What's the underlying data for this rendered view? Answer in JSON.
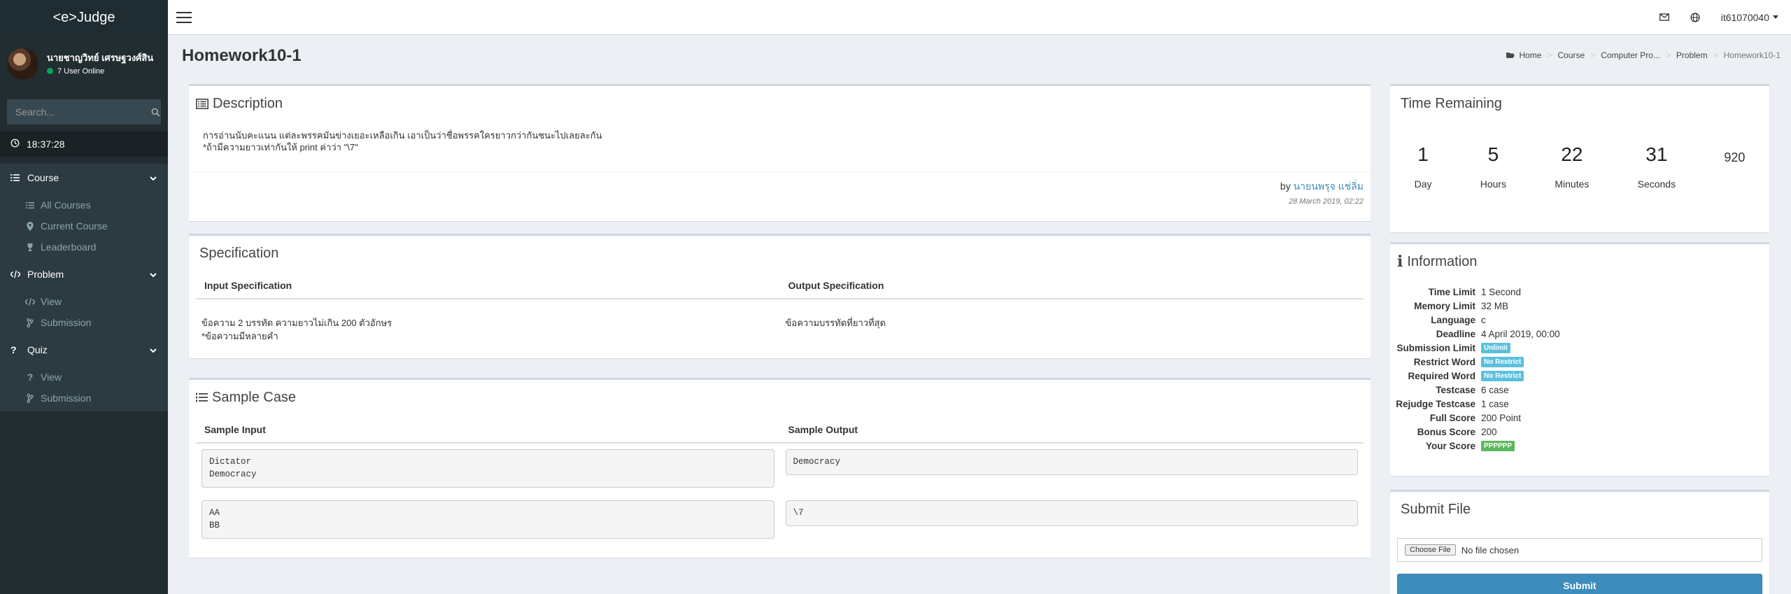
{
  "app": {
    "logo": "<e>Judge"
  },
  "user": {
    "name": "นายชาญวิทย์ เศรษฐวงศ์สิน",
    "status": "7 User Online",
    "username": "it61070040"
  },
  "search": {
    "placeholder": "Search..."
  },
  "clock": "18:37:28",
  "sidebar": {
    "sections": [
      {
        "label": "Course",
        "icon": "list-icon",
        "items": [
          {
            "label": "All Courses",
            "icon": "list-icon"
          },
          {
            "label": "Current Course",
            "icon": "map-marker-icon"
          },
          {
            "label": "Leaderboard",
            "icon": "trophy-icon"
          }
        ]
      },
      {
        "label": "Problem",
        "icon": "code-icon",
        "items": [
          {
            "label": "View",
            "icon": "code-icon"
          },
          {
            "label": "Submission",
            "icon": "git-branch-icon"
          }
        ]
      },
      {
        "label": "Quiz",
        "icon": "question-icon",
        "items": [
          {
            "label": "View",
            "icon": "question-icon"
          },
          {
            "label": "Submission",
            "icon": "git-branch-icon"
          }
        ]
      }
    ]
  },
  "page": {
    "title": "Homework10-1"
  },
  "breadcrumb": [
    "Home",
    "Course",
    "Computer Pro...",
    "Problem",
    "Homework10-1"
  ],
  "description": {
    "title": "Description",
    "lines": [
      "การอ่านนับคะแนน แต่ละพรรคมันข่างเยอะเหลือเกิน เอาเป็นว่าชื่อพรรคใครยาวกว่ากันชนะไปเลยละกัน",
      "*ถ้ามีความยาวเท่ากันให้ print ค่าว่า \"\\7\""
    ],
    "by": "by",
    "author": "นายนพรุจ แช่ลิ่ม",
    "date": "28 March 2019, 02:22"
  },
  "specification": {
    "title": "Specification",
    "input_header": "Input Specification",
    "output_header": "Output Specification",
    "input_lines": [
      "ข้อความ 2 บรรทัด ความยาวไม่เกิน 200 ตัวอักษร",
      "*ข้อความมีหลายคำ"
    ],
    "output_text": "ข้อความบรรทัดที่ยาวที่สุด"
  },
  "sample": {
    "title": "Sample Case",
    "input_header": "Sample Input",
    "output_header": "Sample Output",
    "cases": [
      {
        "input": "Dictator\nDemocracy",
        "output": "Democracy"
      },
      {
        "input": "AA\nBB",
        "output": "\\7"
      }
    ]
  },
  "time_remaining": {
    "title": "Time Remaining",
    "units": [
      {
        "value": "1",
        "label": "Day"
      },
      {
        "value": "5",
        "label": "Hours"
      },
      {
        "value": "22",
        "label": "Minutes"
      },
      {
        "value": "31",
        "label": "Seconds"
      }
    ],
    "extra": "920"
  },
  "information": {
    "title": "Information",
    "rows": [
      {
        "key": "Time Limit",
        "value": "1 Second"
      },
      {
        "key": "Memory Limit",
        "value": "32 MB"
      },
      {
        "key": "Language",
        "value": "c"
      },
      {
        "key": "Deadline",
        "value": "4 April 2019, 00:00"
      },
      {
        "key": "Submission Limit",
        "badge": "Unlimit",
        "badge_color": "#5bc0de"
      },
      {
        "key": "Restrict Word",
        "badge": "No Restrict",
        "badge_color": "#5bc0de"
      },
      {
        "key": "Required Word",
        "badge": "No Restrict",
        "badge_color": "#5bc0de"
      },
      {
        "key": "Testcase",
        "value": "6 case"
      },
      {
        "key": "Rejudge Testcase",
        "value": "1 case"
      },
      {
        "key": "Full Score",
        "value": "200 Point"
      },
      {
        "key": "Bonus Score",
        "value": "200"
      },
      {
        "key": "Your Score",
        "badge": "PPPPPP",
        "badge_color": "#5cb85c"
      }
    ]
  },
  "submit_file": {
    "title": "Submit File",
    "choose_label": "Choose File",
    "no_file": "No file chosen",
    "submit_label": "Submit"
  },
  "colors": {
    "sidebar_bg": "#222d32",
    "accent": "#3c8dbc",
    "badge_info": "#5bc0de",
    "badge_success": "#5cb85c"
  }
}
